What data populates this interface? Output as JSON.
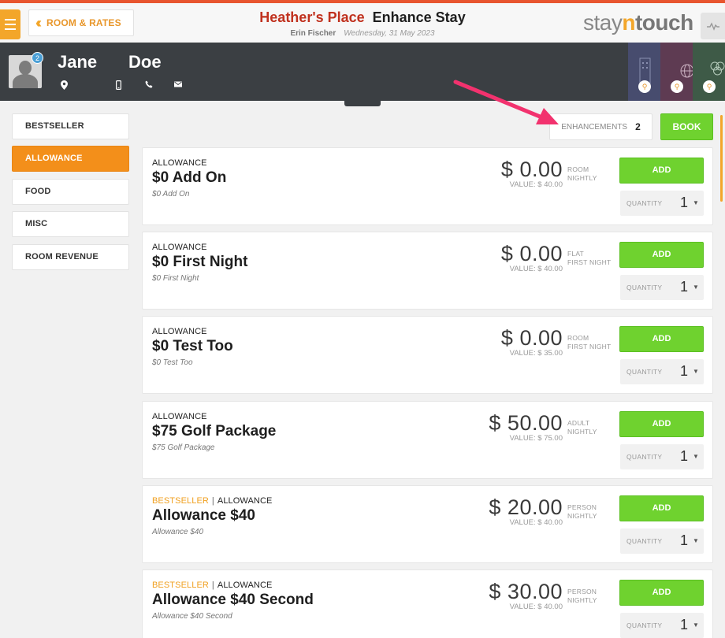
{
  "header": {
    "back_label": "ROOM & RATES",
    "hotel_name": "Heather's Place",
    "page_title": "Enhance Stay",
    "user_name": "Erin Fischer",
    "date": "Wednesday, 31 May 2023",
    "brand_prefix": "stay",
    "brand_n": "n",
    "brand_suffix": "touch"
  },
  "guest": {
    "first_name": "Jane",
    "last_name": "Doe",
    "avatar_badge": "2"
  },
  "sidebar": {
    "items": [
      {
        "label": "BESTSELLER",
        "active": false
      },
      {
        "label": "ALLOWANCE",
        "active": true
      },
      {
        "label": "FOOD",
        "active": false
      },
      {
        "label": "MISC",
        "active": false
      },
      {
        "label": "ROOM REVENUE",
        "active": false
      }
    ]
  },
  "actions": {
    "enhancements_label": "ENHANCEMENTS",
    "enhancements_count": "2",
    "book_label": "BOOK"
  },
  "cards": [
    {
      "bestseller": "",
      "category": "ALLOWANCE",
      "name": "$0 Add On",
      "desc": "$0 Add On",
      "price": "$ 0.00",
      "unit1": "ROOM",
      "unit2": "NIGHTLY",
      "value": "VALUE: $ 40.00",
      "add_label": "ADD",
      "qty_label": "QUANTITY",
      "qty": "1"
    },
    {
      "bestseller": "",
      "category": "ALLOWANCE",
      "name": "$0 First Night",
      "desc": "$0 First Night",
      "price": "$ 0.00",
      "unit1": "FLAT",
      "unit2": "FIRST NIGHT",
      "value": "VALUE: $ 40.00",
      "add_label": "ADD",
      "qty_label": "QUANTITY",
      "qty": "1"
    },
    {
      "bestseller": "",
      "category": "ALLOWANCE",
      "name": "$0 Test Too",
      "desc": "$0 Test Too",
      "price": "$ 0.00",
      "unit1": "ROOM",
      "unit2": "FIRST NIGHT",
      "value": "VALUE: $ 35.00",
      "add_label": "ADD",
      "qty_label": "QUANTITY",
      "qty": "1"
    },
    {
      "bestseller": "",
      "category": "ALLOWANCE",
      "name": "$75 Golf Package",
      "desc": "$75 Golf Package",
      "price": "$ 50.00",
      "unit1": "ADULT",
      "unit2": "NIGHTLY",
      "value": "VALUE: $ 75.00",
      "add_label": "ADD",
      "qty_label": "QUANTITY",
      "qty": "1"
    },
    {
      "bestseller": "BESTSELLER",
      "category": "ALLOWANCE",
      "name": "Allowance $40",
      "desc": "Allowance $40",
      "price": "$ 20.00",
      "unit1": "PERSON",
      "unit2": "NIGHTLY",
      "value": "VALUE: $ 40.00",
      "add_label": "ADD",
      "qty_label": "QUANTITY",
      "qty": "1"
    },
    {
      "bestseller": "BESTSELLER",
      "category": "ALLOWANCE",
      "name": "Allowance $40 Second",
      "desc": "Allowance $40 Second",
      "price": "$ 30.00",
      "unit1": "PERSON",
      "unit2": "NIGHTLY",
      "value": "VALUE: $ 40.00",
      "add_label": "ADD",
      "qty_label": "QUANTITY",
      "qty": "1"
    }
  ],
  "colors": {
    "accent_orange": "#f3a62a",
    "active_tab": "#f38f1a",
    "add_green": "#6fd22f",
    "hotel_red": "#c0311e",
    "guest_bar": "#3b3f43",
    "annotation_arrow": "#f2326e"
  },
  "icons": [
    "menu-icon",
    "double-chevron-left-icon",
    "pulse-icon",
    "location-pin-icon",
    "mobile-phone-icon",
    "phone-icon",
    "mail-icon",
    "search-icon"
  ]
}
